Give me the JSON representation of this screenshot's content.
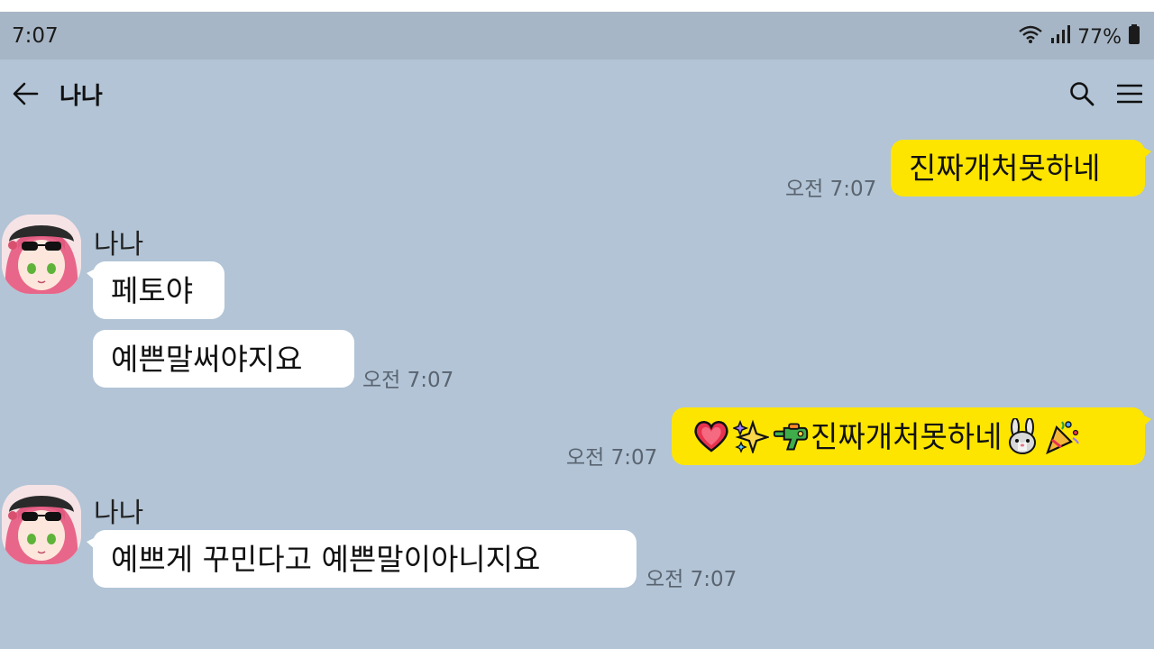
{
  "status_bar": {
    "time": "7:07",
    "battery": "77%"
  },
  "header": {
    "title": "나나"
  },
  "messages": [
    {
      "direction": "outgoing",
      "text": "진짜개처못하네",
      "time": "오전 7:07"
    },
    {
      "direction": "incoming",
      "sender": "나나",
      "text": "페토야"
    },
    {
      "direction": "incoming",
      "text": "예쁜말써야지요",
      "time": "오전 7:07"
    },
    {
      "direction": "outgoing",
      "text": "진짜개처못하네",
      "emoji_before": [
        "heart-emoji",
        "sparkles-emoji",
        "water-pistol-emoji"
      ],
      "emoji_after": [
        "rabbit-emoji",
        "party-popper-emoji"
      ],
      "time": "오전 7:07"
    },
    {
      "direction": "incoming",
      "sender": "나나",
      "text": "예쁘게 꾸민다고 예쁜말이아니지요",
      "time": "오전 7:07"
    }
  ],
  "colors": {
    "background": "#b2c4d6",
    "outgoing_bubble": "#fee500",
    "incoming_bubble": "#ffffff"
  }
}
